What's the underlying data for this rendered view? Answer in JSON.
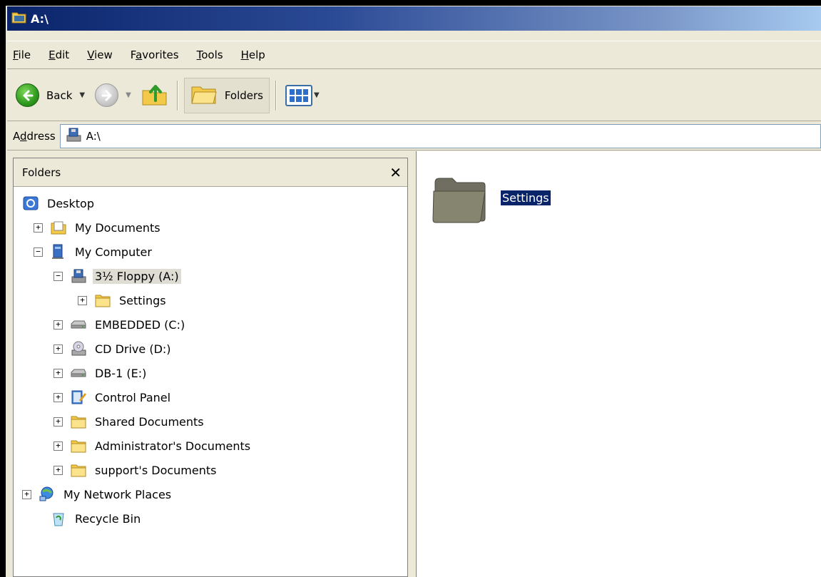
{
  "window": {
    "title": "A:\\"
  },
  "menu": [
    {
      "pre": "",
      "key": "F",
      "post": "ile"
    },
    {
      "pre": "",
      "key": "E",
      "post": "dit"
    },
    {
      "pre": "",
      "key": "V",
      "post": "iew"
    },
    {
      "pre": "F",
      "key": "a",
      "post": "vorites"
    },
    {
      "pre": "",
      "key": "T",
      "post": "ools"
    },
    {
      "pre": "",
      "key": "H",
      "post": "elp"
    }
  ],
  "toolbar": {
    "back_label": "Back",
    "folders_label": "Folders"
  },
  "address": {
    "label": "Address",
    "value": "A:\\"
  },
  "folders_pane": {
    "title": "Folders",
    "close_glyph": "✕",
    "tree": [
      {
        "label": "Desktop",
        "level": 0,
        "expander": "",
        "icon": "desktop-icon"
      },
      {
        "label": "My Documents",
        "level": 1,
        "expander": "+",
        "icon": "my-documents-icon"
      },
      {
        "label": "My Computer",
        "level": 1,
        "expander": "−",
        "icon": "my-computer-icon"
      },
      {
        "label": "3½ Floppy (A:)",
        "level": 2,
        "expander": "−",
        "icon": "floppy-drive-icon",
        "selected": true
      },
      {
        "label": "Settings",
        "level": 3,
        "expander": "+",
        "icon": "folder-icon"
      },
      {
        "label": "EMBEDDED (C:)",
        "level": 2,
        "expander": "+",
        "icon": "hard-drive-icon"
      },
      {
        "label": "CD Drive (D:)",
        "level": 2,
        "expander": "+",
        "icon": "cd-drive-icon"
      },
      {
        "label": "DB-1 (E:)",
        "level": 2,
        "expander": "+",
        "icon": "hard-drive-icon"
      },
      {
        "label": "Control Panel",
        "level": 2,
        "expander": "+",
        "icon": "control-panel-icon"
      },
      {
        "label": "Shared Documents",
        "level": 2,
        "expander": "+",
        "icon": "folder-icon"
      },
      {
        "label": "Administrator's Documents",
        "level": 2,
        "expander": "+",
        "icon": "folder-icon"
      },
      {
        "label": "support's Documents",
        "level": 2,
        "expander": "+",
        "icon": "folder-icon"
      },
      {
        "label": "My Network Places",
        "level": 0,
        "expander": "+",
        "icon": "network-places-icon"
      },
      {
        "label": "Recycle Bin",
        "level": 1,
        "expander": "",
        "icon": "recycle-bin-icon"
      }
    ]
  },
  "content": {
    "items": [
      {
        "label": "Settings",
        "icon": "folder-icon",
        "selected": true
      }
    ]
  },
  "colors": {
    "titlebar_start": "#0a246a",
    "titlebar_end": "#a6caf0",
    "selection": "#0a246a",
    "chrome": "#ece9d8"
  }
}
